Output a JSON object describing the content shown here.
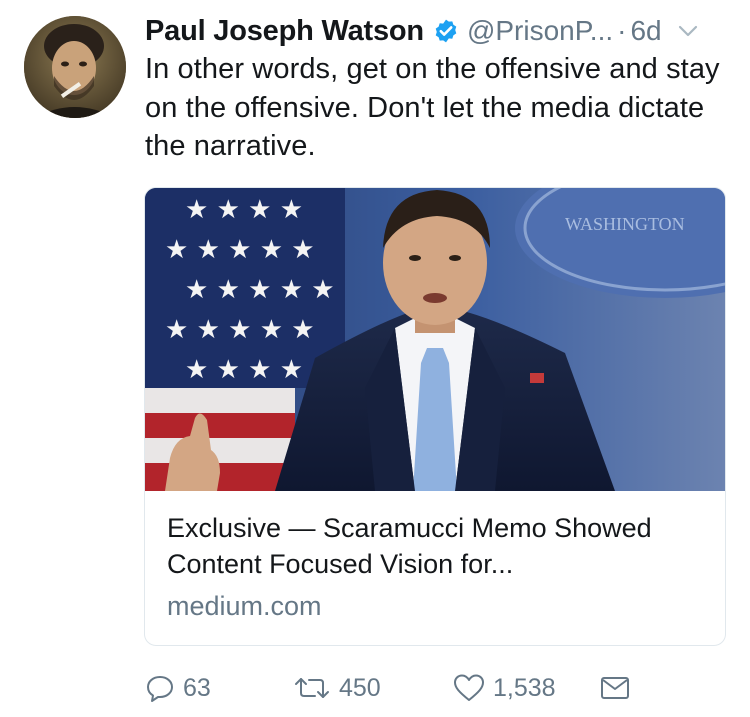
{
  "tweet": {
    "author": {
      "display_name": "Paul Joseph Watson",
      "handle": "@PrisonP...",
      "verified": true,
      "avatar_icon": "user-avatar"
    },
    "separator": "·",
    "time": "6d",
    "text": "In other words, get on the offensive and stay on the offensive. Don't let the media dictate the narrative.",
    "card": {
      "image_icon": "press-briefing-photo",
      "image_sign_text": "WASHINGTON",
      "title": "Exclusive — Scaramucci Memo Showed Content Focused Vision for...",
      "domain": "medium.com"
    },
    "actions": {
      "replies": "63",
      "retweets": "450",
      "likes": "1,538"
    }
  },
  "colors": {
    "text": "#14171a",
    "secondary": "#657786",
    "verified_blue": "#1da1f2",
    "border": "#e1e8ed"
  }
}
